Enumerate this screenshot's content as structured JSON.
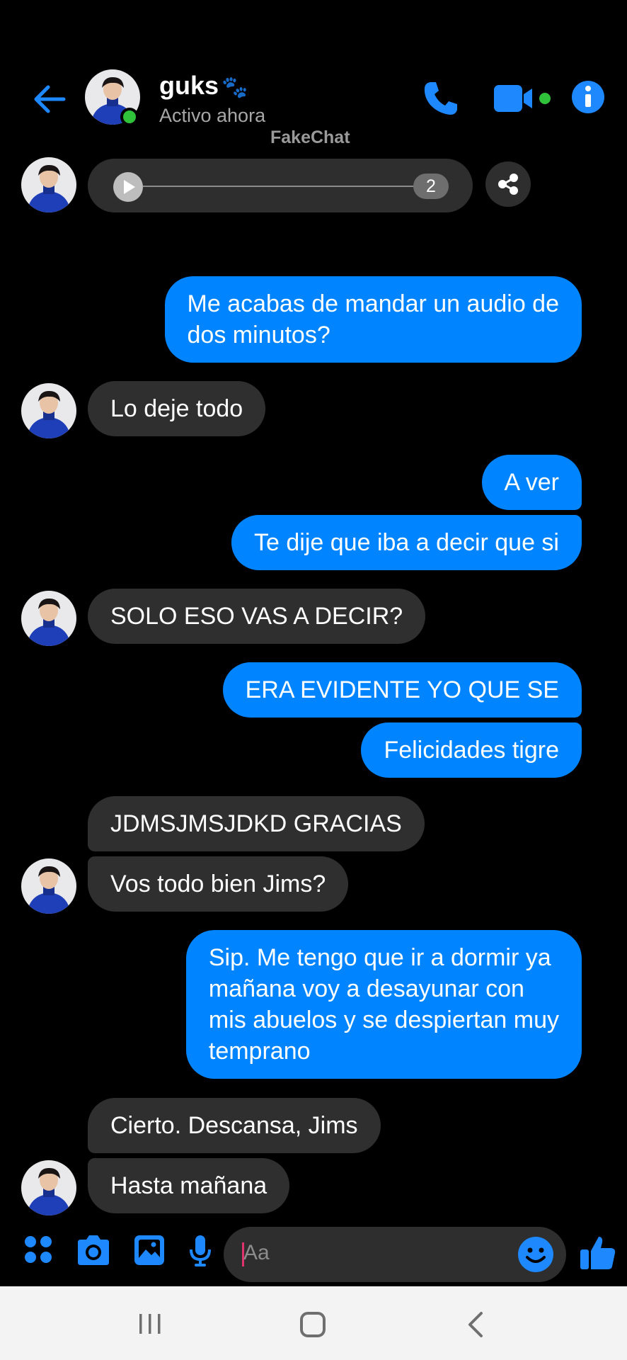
{
  "header": {
    "contact_name": "guks",
    "name_emoji": "🐾",
    "status": "Activo ahora",
    "watermark": "FakeChat",
    "icons": [
      "back-arrow-icon",
      "phone-icon",
      "video-camera-icon",
      "info-icon"
    ]
  },
  "audio_message": {
    "count_badge": "2",
    "icons": [
      "play-icon",
      "share-icon"
    ]
  },
  "messages": [
    {
      "side": "out",
      "text": "Me acabas de mandar un audio de\ndos minutos?"
    },
    {
      "side": "in",
      "text": "Lo deje todo"
    },
    {
      "side": "out",
      "text": "A ver"
    },
    {
      "side": "out",
      "text": "Te dije que iba a decir que si"
    },
    {
      "side": "in",
      "text": "SOLO ESO VAS A DECIR?"
    },
    {
      "side": "out",
      "text": "ERA EVIDENTE YO QUE SE"
    },
    {
      "side": "out",
      "text": "Felicidades tigre"
    },
    {
      "side": "in",
      "text": "JDMSJMSJDKD GRACIAS"
    },
    {
      "side": "in",
      "text": "Vos todo bien Jims?"
    },
    {
      "side": "out",
      "text": "Sip. Me tengo que ir a dormir ya\nmañana voy a desayunar con\nmis abuelos y se despiertan muy\ntemprano"
    },
    {
      "side": "in",
      "text": "Cierto. Descansa, Jims"
    },
    {
      "side": "in",
      "text": "Hasta mañana"
    }
  ],
  "composer": {
    "placeholder": "Aa",
    "icons": [
      "apps-grid-icon",
      "camera-icon",
      "image-icon",
      "microphone-icon",
      "emoji-icon",
      "thumbs-up-icon"
    ]
  },
  "colors": {
    "accent": "#0084ff",
    "incoming_bubble": "#2f2f2f",
    "background": "#000000",
    "online": "#31c23c"
  }
}
